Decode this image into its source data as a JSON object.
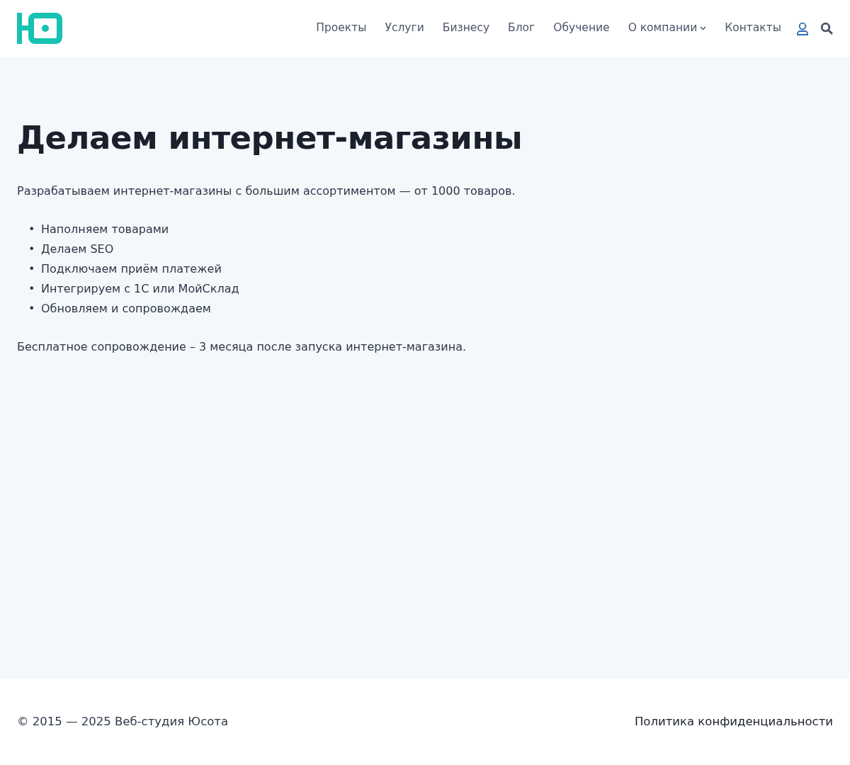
{
  "nav": [
    {
      "label": "Проекты",
      "dropdown": false
    },
    {
      "label": "Услуги",
      "dropdown": false
    },
    {
      "label": "Бизнесу",
      "dropdown": false
    },
    {
      "label": "Блог",
      "dropdown": false
    },
    {
      "label": "Обучение",
      "dropdown": false
    },
    {
      "label": "О компании",
      "dropdown": true
    },
    {
      "label": "Контакты",
      "dropdown": false
    }
  ],
  "content": {
    "title": "Делаем интернет-магазины",
    "intro": "Разрабатываем интернет-магазины с большим ассортиментом — от 1000 товаров.",
    "bullets": [
      {
        "marker": "•",
        "text": "Наполняем товарами"
      },
      {
        "marker": "•",
        "text": "Делаем SEO"
      },
      {
        "marker": "•",
        "text": "Подключаем приём платежей"
      },
      {
        "marker": "•",
        "text": "Интегрируем с 1С или МойСклад"
      },
      {
        "marker": "•",
        "text": "Обновляем и сопровождаем"
      }
    ],
    "note": "Бесплатное сопровождение – 3 месяца после запуска интернет-магазина."
  },
  "footer": {
    "copyright": "© 2015 — 2025 Веб-студия Юсота",
    "link": "Политика конфиденциальности"
  }
}
